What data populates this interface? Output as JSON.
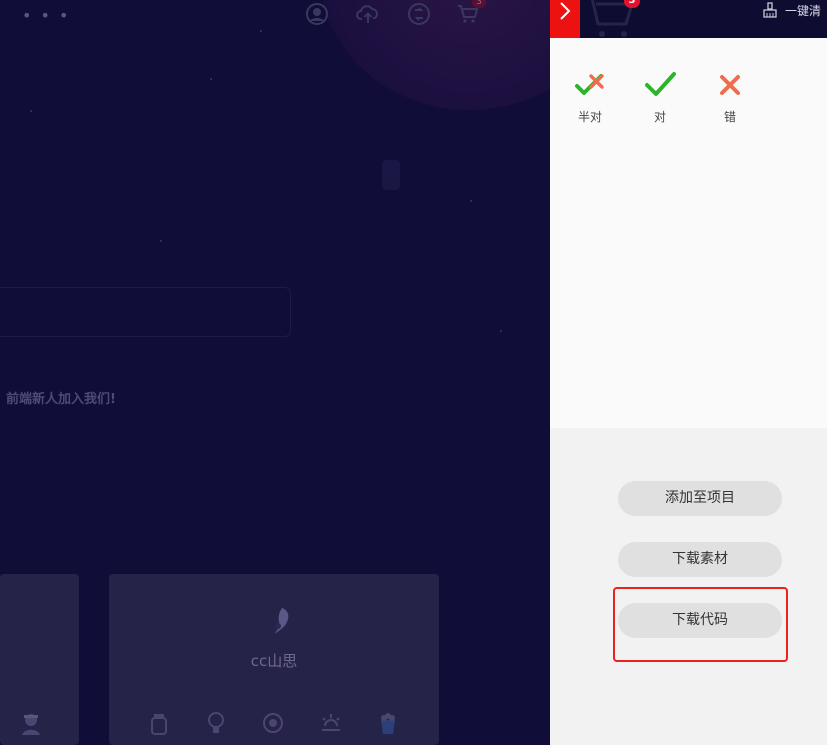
{
  "background_page": {
    "menu_dots": "• • •",
    "cart_badge": "3",
    "promo_text": "前端新人加入我们!",
    "card_name": "cc山思",
    "icons": [
      "user-icon",
      "upload-icon",
      "shuffle-icon",
      "cart-icon",
      "bottle-icon",
      "lightbulb-icon",
      "refresh-icon",
      "sunrise-icon",
      "popcorn-icon",
      "avatar-icon",
      "brand-logo-icon"
    ]
  },
  "panel": {
    "cart_badge": "3",
    "clear_label": "一键清",
    "items": [
      {
        "label": "半对",
        "icon": "half-correct-icon"
      },
      {
        "label": "对",
        "icon": "check-icon"
      },
      {
        "label": "错",
        "icon": "cross-icon"
      }
    ],
    "buttons": {
      "add_to_project": "添加至项目",
      "download_assets": "下载素材",
      "download_code": "下载代码"
    }
  },
  "colors": {
    "overlay_background": "#100d38",
    "close_tab": "#ee1111",
    "check_green": "#2db42d",
    "cross_red": "#f26b4d",
    "highlight_border": "#e8221f"
  }
}
